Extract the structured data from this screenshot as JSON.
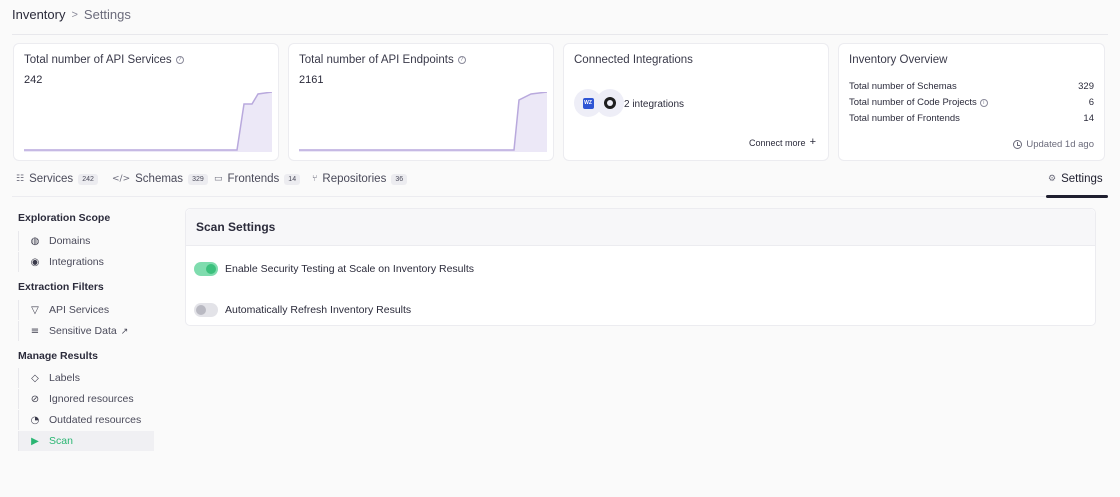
{
  "breadcrumb": {
    "root": "Inventory",
    "separator": ">",
    "current": "Settings"
  },
  "cards": {
    "api_services": {
      "title": "Total number of API Services",
      "value": "242"
    },
    "api_endpoints": {
      "title": "Total number of API Endpoints",
      "value": "2161"
    },
    "integrations": {
      "title": "Connected Integrations",
      "icon_1_text": "WZ",
      "count_label": "2 integrations",
      "connect_label": "Connect more"
    },
    "overview": {
      "title": "Inventory Overview",
      "rows": [
        {
          "label": "Total number of Schemas",
          "value": "329"
        },
        {
          "label": "Total number of Code Projects",
          "value": "6"
        },
        {
          "label": "Total number of Frontends",
          "value": "14"
        }
      ],
      "updated": "Updated 1d ago"
    }
  },
  "tabs": [
    {
      "label": "Services",
      "count": "242",
      "icon": "list-icon"
    },
    {
      "label": "Schemas",
      "count": "329",
      "icon": "code-icon"
    },
    {
      "label": "Frontends",
      "count": "14",
      "icon": "window-icon"
    },
    {
      "label": "Repositories",
      "count": "36",
      "icon": "branch-icon"
    },
    {
      "label": "Settings",
      "icon": "gear-icon",
      "active": true
    }
  ],
  "sidebar": {
    "sections": [
      {
        "title": "Exploration Scope",
        "items": [
          {
            "label": "Domains",
            "icon": "globe-icon"
          },
          {
            "label": "Integrations",
            "icon": "eye-icon"
          }
        ]
      },
      {
        "title": "Extraction Filters",
        "items": [
          {
            "label": "API Services",
            "icon": "filter-icon"
          },
          {
            "label": "Sensitive Data",
            "icon": "database-icon",
            "external": true
          }
        ]
      },
      {
        "title": "Manage Results",
        "items": [
          {
            "label": "Labels",
            "icon": "tag-icon"
          },
          {
            "label": "Ignored resources",
            "icon": "eye-off-icon"
          },
          {
            "label": "Outdated resources",
            "icon": "outdated-icon"
          },
          {
            "label": "Scan",
            "icon": "play-icon",
            "active": true
          }
        ]
      }
    ]
  },
  "settings_panel": {
    "title": "Scan Settings",
    "toggles": [
      {
        "label": "Enable Security Testing at Scale on Inventory Results",
        "enabled": true
      },
      {
        "label": "Automatically Refresh Inventory Results",
        "enabled": false
      }
    ]
  },
  "colors": {
    "accent_green": "#2bb673",
    "spark_fill": "#ece8f7",
    "spark_stroke": "#b9a9dd"
  }
}
